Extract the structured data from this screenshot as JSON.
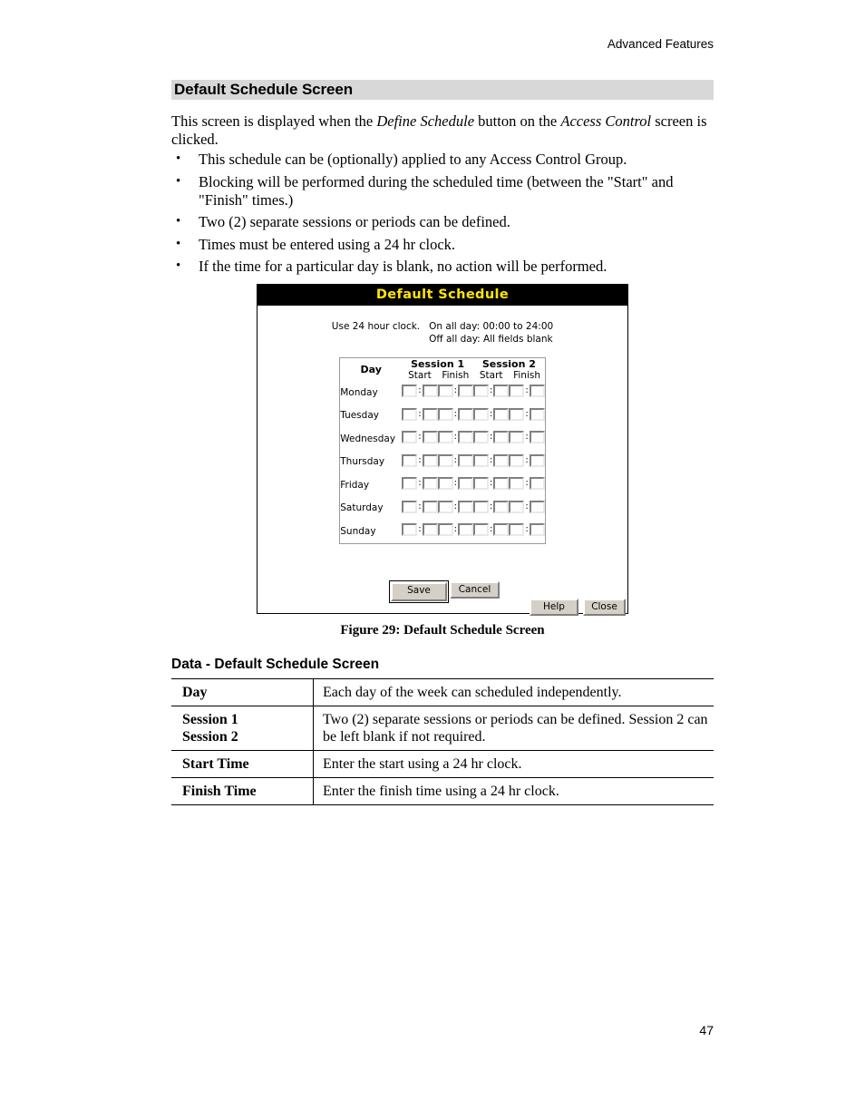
{
  "header": {
    "running_head": "Advanced Features"
  },
  "section": {
    "heading": "Default Schedule Screen",
    "intro_before": "This screen is displayed when the ",
    "intro_em1": "Define Schedule",
    "intro_mid": " button on the ",
    "intro_em2": "Access Control",
    "intro_after": " screen is clicked.",
    "bullets": [
      "This schedule can be (optionally) applied to any Access Control Group.",
      "Blocking will be performed during the scheduled time (between the \"Start\" and \"Finish\" times.)",
      "Two (2) separate sessions or periods can be defined.",
      "Times must be entered using a 24 hr clock.",
      "If the time for a particular day is blank, no action will be performed."
    ],
    "bullet_marker": "•"
  },
  "figure": {
    "titlebar": "Default Schedule",
    "title_color": "#ffe600",
    "titlebar_background": "#000000",
    "instructions": {
      "left": "Use 24 hour clock.",
      "right_line1": "On all day: 00:00 to 24:00",
      "right_line2": "Off all day: All fields blank"
    },
    "table": {
      "day_header": "Day",
      "sessions": [
        {
          "label": "Session 1",
          "columns": [
            "Start",
            "Finish"
          ]
        },
        {
          "label": "Session 2",
          "columns": [
            "Start",
            "Finish"
          ]
        }
      ],
      "colon": ":",
      "days": [
        "Monday",
        "Tuesday",
        "Wednesday",
        "Thursday",
        "Friday",
        "Saturday",
        "Sunday"
      ],
      "field_values": {
        "session1_start_hour": "",
        "session1_start_min": "",
        "session1_finish_hour": "",
        "session1_finish_min": "",
        "session2_start_hour": "",
        "session2_start_min": "",
        "session2_finish_hour": "",
        "session2_finish_min": ""
      }
    },
    "buttons": {
      "save": "Save",
      "cancel": "Cancel",
      "help": "Help",
      "close": "Close"
    },
    "caption": "Figure 29: Default Schedule Screen"
  },
  "data_section": {
    "heading": "Data - Default Schedule Screen",
    "rows": [
      {
        "key": "Day",
        "key_line2": "",
        "value": "Each day of the week can scheduled independently."
      },
      {
        "key": "Session 1",
        "key_line2": "Session 2",
        "value": "Two (2) separate sessions or periods can be defined. Session 2 can be left blank if not required."
      },
      {
        "key": "Start Time",
        "key_line2": "",
        "value": "Enter the start using a 24 hr clock."
      },
      {
        "key": "Finish Time",
        "key_line2": "",
        "value": "Enter the finish time using a 24 hr clock."
      }
    ]
  },
  "footer": {
    "page_number": "47"
  }
}
